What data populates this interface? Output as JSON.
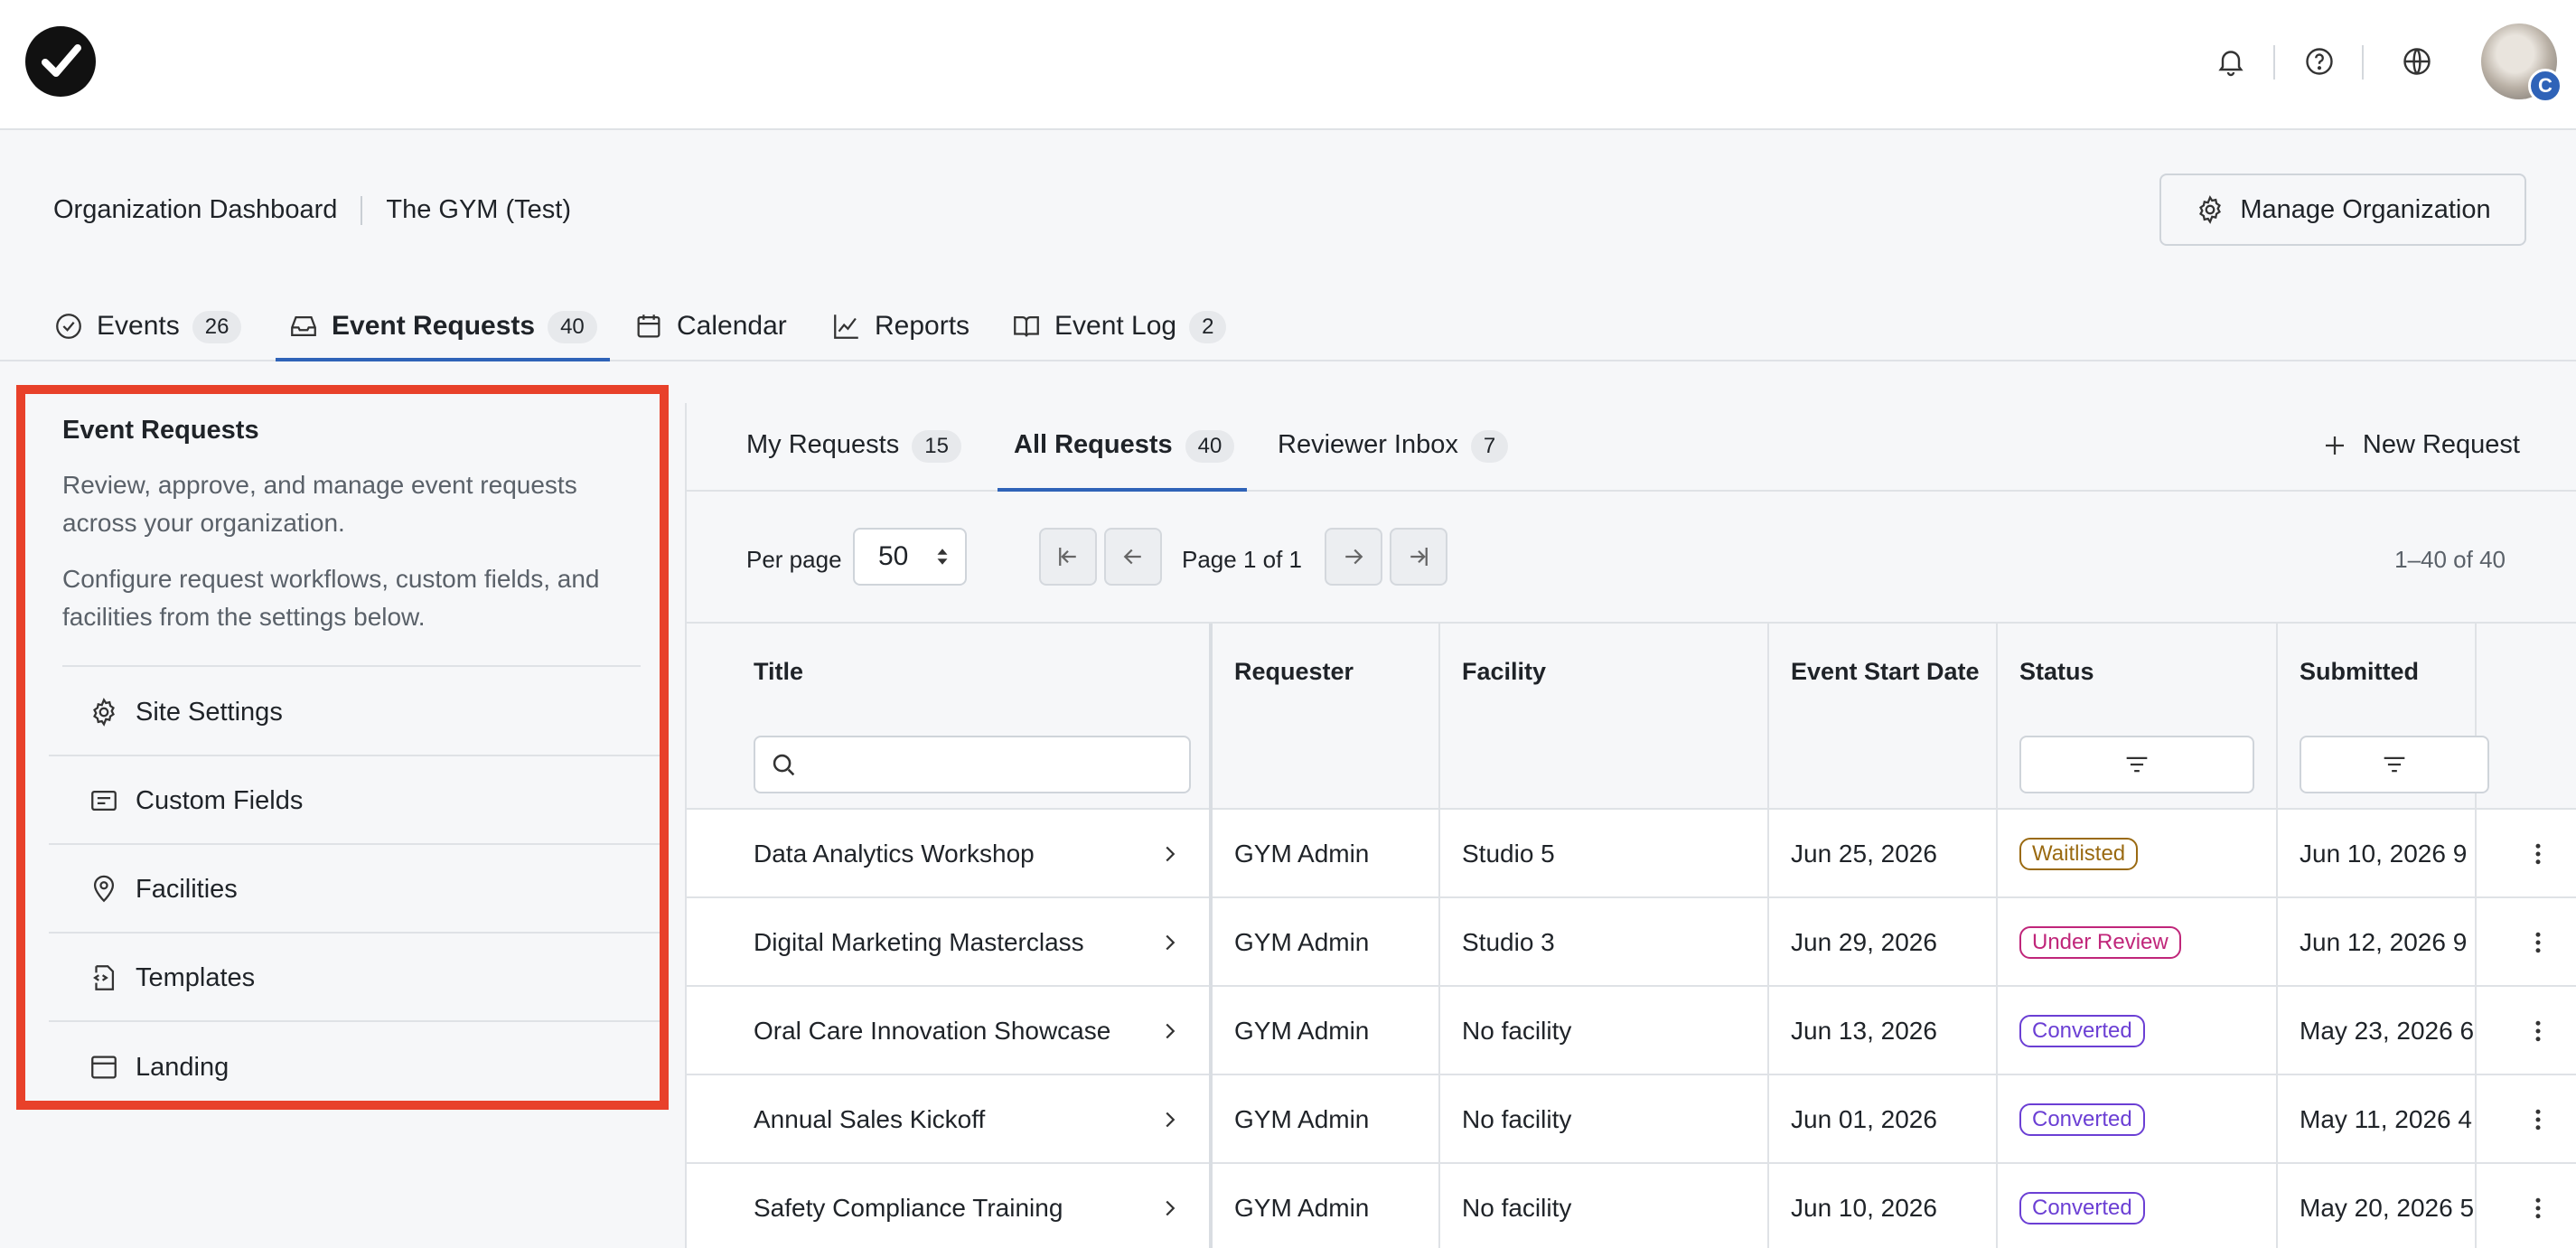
{
  "header": {
    "org_dashboard": "Organization Dashboard",
    "org_name": "The GYM (Test)",
    "manage_label": "Manage Organization",
    "avatar_badge": "C"
  },
  "main_tabs": [
    {
      "label": "Events",
      "count": "26",
      "icon": "check-circle-icon"
    },
    {
      "label": "Event Requests",
      "count": "40",
      "icon": "inbox-icon"
    },
    {
      "label": "Calendar",
      "count": "",
      "icon": "calendar-icon"
    },
    {
      "label": "Reports",
      "count": "",
      "icon": "chart-line-icon"
    },
    {
      "label": "Event Log",
      "count": "2",
      "icon": "book-icon"
    }
  ],
  "left_panel": {
    "title": "Event Requests",
    "description": "Review, approve, and manage event requests across your organization.",
    "description2": "Configure request workflows, custom fields, and facilities from the settings below.",
    "items": [
      {
        "label": "Site Settings",
        "icon": "gear-icon"
      },
      {
        "label": "Custom Fields",
        "icon": "form-icon"
      },
      {
        "label": "Facilities",
        "icon": "location-pin-icon"
      },
      {
        "label": "Templates",
        "icon": "template-icon"
      },
      {
        "label": "Landing",
        "icon": "browser-window-icon"
      }
    ]
  },
  "sub_tabs": [
    {
      "label": "My Requests",
      "count": "15"
    },
    {
      "label": "All Requests",
      "count": "40"
    },
    {
      "label": "Reviewer Inbox",
      "count": "7"
    }
  ],
  "new_request_label": "New Request",
  "pagination": {
    "per_page_label": "Per page",
    "per_page_value": "50",
    "page_text": "Page 1 of 1",
    "range_text": "1–40 of 40"
  },
  "table": {
    "columns": [
      "Title",
      "Requester",
      "Facility",
      "Event Start Date",
      "Status",
      "Submitted"
    ],
    "rows": [
      {
        "title": "Data Analytics Workshop",
        "requester": "GYM Admin",
        "facility": "Studio 5",
        "start": "Jun 25, 2026",
        "status": "Waitlisted",
        "status_color": "#9a6a12",
        "submitted": "Jun 10, 2026 9"
      },
      {
        "title": "Digital Marketing Masterclass",
        "requester": "GYM Admin",
        "facility": "Studio 3",
        "start": "Jun 29, 2026",
        "status": "Under Review",
        "status_color": "#c0267a",
        "submitted": "Jun 12, 2026 9"
      },
      {
        "title": "Oral Care Innovation Showcase",
        "requester": "GYM Admin",
        "facility": "No facility",
        "start": "Jun 13, 2026",
        "status": "Converted",
        "status_color": "#6b3fd4",
        "submitted": "May 23, 2026 6"
      },
      {
        "title": "Annual Sales Kickoff",
        "requester": "GYM Admin",
        "facility": "No facility",
        "start": "Jun 01, 2026",
        "status": "Converted",
        "status_color": "#6b3fd4",
        "submitted": "May 11, 2026 4"
      },
      {
        "title": "Safety Compliance Training",
        "requester": "GYM Admin",
        "facility": "No facility",
        "start": "Jun 10, 2026",
        "status": "Converted",
        "status_color": "#6b3fd4",
        "submitted": "May 20, 2026 5"
      }
    ]
  },
  "colors": {
    "accent": "#2f63b8",
    "highlight_border": "#e8412a"
  }
}
